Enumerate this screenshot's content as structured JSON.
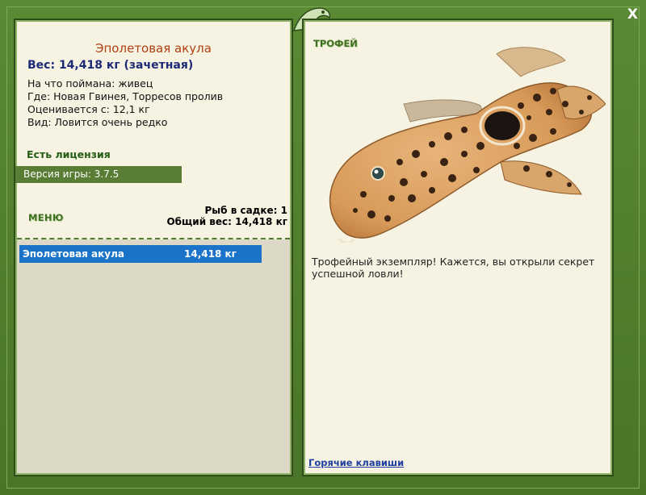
{
  "window": {
    "close_label": "X"
  },
  "fish": {
    "name": "Эполетовая акула",
    "weight_line": "Вес: 14,418 кг (зачетная)",
    "caught_on": "На что поймана: живец",
    "location": "Где: Новая Гвинея, Торресов пролив",
    "rated_from": "Оценивается с: 12,1 кг",
    "rarity": "Вид: Ловится очень редко"
  },
  "license": "Есть лицензия",
  "version": "Версия игры: 3.7.5",
  "menu_label": "МЕНЮ",
  "cage": {
    "count_line": "Рыб в садке: 1",
    "total_line": "Общий вес: 14,418 кг"
  },
  "catch_list": [
    {
      "name": "Эполетовая акула",
      "weight": "14,418 кг"
    }
  ],
  "trophy": {
    "label": "ТРОФЕЙ",
    "description": "Трофейный экземпляр! Кажется, вы открыли секрет успешной ловли!",
    "image": "epaulette-shark-image"
  },
  "hotkeys_link": "Горячие клавиши",
  "colors": {
    "frame_green": "#4e7a2e",
    "panel_bg": "#f7f3e2",
    "selection_blue": "#1a73c8",
    "title_orange": "#b04012",
    "weight_navy": "#1d2a78"
  }
}
